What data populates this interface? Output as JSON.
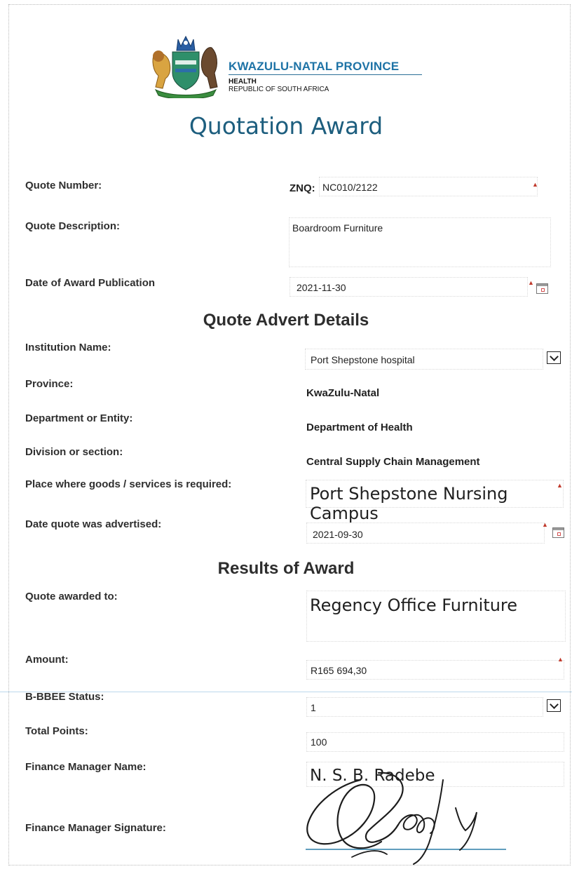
{
  "header": {
    "province_title": "KWAZULU-NATAL PROVINCE",
    "sub1": "HEALTH",
    "sub2": "REPUBLIC OF SOUTH AFRICA",
    "logo": "provincial-crest"
  },
  "title": "Quotation Award",
  "quote": {
    "number_label": "Quote Number:",
    "number_prefix": "ZNQ:",
    "number_value": "NC010/2122",
    "description_label": "Quote Description:",
    "description_value": "Boardroom Furniture",
    "award_date_label": "Date of Award Publication",
    "award_date_value": "2021-11-30"
  },
  "advert": {
    "heading": "Quote Advert Details",
    "institution_label": "Institution Name:",
    "institution_value": "Port Shepstone  hospital",
    "province_label": "Province:",
    "province_value": "KwaZulu-Natal",
    "department_label": "Department or Entity:",
    "department_value": "Department of Health",
    "division_label": "Division or section:",
    "division_value": "Central Supply Chain Management",
    "place_label": "Place where goods /  services is required:",
    "place_value": "Port Shepstone Nursing Campus",
    "advertised_label": "Date quote was advertised:",
    "advertised_value": "2021-09-30"
  },
  "results": {
    "heading": "Results of Award",
    "awarded_label": "Quote awarded to:",
    "awarded_value": "Regency Office Furniture",
    "amount_label": "Amount:",
    "amount_value": "R165 694,30",
    "bbbee_label": "B-BBEE Status:",
    "bbbee_value": "1",
    "points_label": "Total Points:",
    "points_value": "100",
    "fm_name_label": "Finance Manager Name:",
    "fm_name_value": "N. S. B. Radebe",
    "fm_sig_label": "Finance Manager Signature:"
  },
  "colors": {
    "title": "#1d5e7e",
    "province_title": "#1e73a6",
    "required_marker": "#c0392b"
  }
}
